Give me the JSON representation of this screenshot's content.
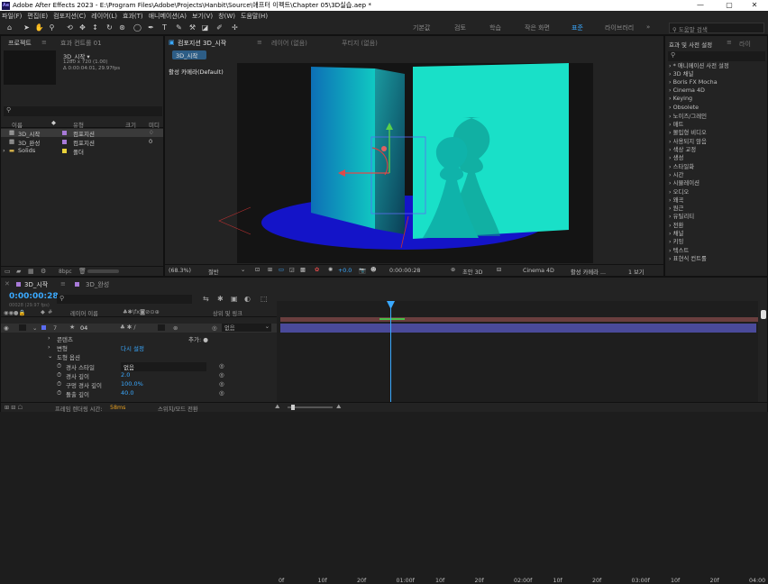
{
  "title": "Adobe After Effects 2023 - E:\\Program Files\\Adobe\\Projects\\Hanbit\\Source\\애프터 이펙트\\Chapter 05\\3D실습.aep *",
  "menu": [
    "파일(F)",
    "편집(E)",
    "컴포지션(C)",
    "레이어(L)",
    "효과(T)",
    "애니메이션(A)",
    "보기(V)",
    "창(W)",
    "도움말(H)"
  ],
  "workspaces": [
    "기본값",
    "검토",
    "학습",
    "작은 화면",
    "표준",
    "라이브러리"
  ],
  "active_workspace": "표준",
  "search_help_placeholder": "도움말 검색",
  "project": {
    "tab": "프로젝트",
    "effect_controls_tab": "효과 컨트롤 01",
    "comp_name": "3D_시작 ▾",
    "comp_info1": "1280 x 720 (1.00)",
    "comp_info2": "Δ 0:00:04:01, 29.97fps",
    "search_placeholder": "",
    "columns": [
      "이름",
      "유형",
      "크기",
      "미디"
    ],
    "items": [
      {
        "name": "3D_시작",
        "color": "#a87ad8",
        "type": "컴포지션",
        "size": "",
        "extra": "♢"
      },
      {
        "name": "3D_완성",
        "color": "#a87ad8",
        "type": "컴포지션",
        "size": "",
        "extra": "0"
      },
      {
        "name": "Solids",
        "color": "#e8d13a",
        "type": "폴더",
        "size": "",
        "extra": ""
      }
    ],
    "bpc": "8bpc"
  },
  "viewer": {
    "tab_comp": "컴포지션 3D_시작",
    "tab_layer": "레이어 (없음)",
    "tab_footage": "푸티지 (없음)",
    "breadcrumb": "3D_시작",
    "camera_label": "활성 카메라(Default)",
    "zoom": "(68.3%)",
    "quality": "절반",
    "timecode": "0:00:00:28",
    "exposure": "+0.0",
    "draft3d": "초안 3D",
    "renderer": "Cinema 4D",
    "camera_select": "활성 카메라 ...",
    "views": "1 보기"
  },
  "effects_panel": {
    "tab": "효과 및 사전 설정",
    "tab2": "라이",
    "search_placeholder": "",
    "categories": [
      "* 애니메이션 사전 설정",
      "3D 채널",
      "Boris FX Mocha",
      "Cinema 4D",
      "Keying",
      "Obsolete",
      "노이즈/그레인",
      "매트",
      "몰입형 비디오",
      "사용되지 않음",
      "색상 교정",
      "생성",
      "스타일화",
      "시간",
      "시뮬레이션",
      "오디오",
      "왜곡",
      "원근",
      "유틸리티",
      "전환",
      "채널",
      "키잉",
      "텍스트",
      "표현식 컨트롤"
    ]
  },
  "timeline": {
    "tab1": "3D_시작",
    "tab2": "3D_완성",
    "timecode": "0:00:00:28",
    "frames": "00028 (29.97 fps)",
    "ruler": [
      "0f",
      "10f",
      "20f",
      "01:00f",
      "10f",
      "20f",
      "02:00f",
      "10f",
      "20f",
      "03:00f",
      "10f",
      "20f",
      "04:00"
    ],
    "header": {
      "layer_name": "레이어 이름",
      "parent": "상위 및 링크",
      "switches": "♣✱\\fx◙⊘⊙⊕"
    },
    "layers": [
      {
        "num": "7",
        "name": "04",
        "parent": "없음"
      }
    ],
    "props": [
      {
        "name": "콘텐츠",
        "value": "",
        "indent": 1,
        "add": "추가: ●"
      },
      {
        "name": "변형",
        "value": "다시 설정",
        "indent": 1,
        "add": ""
      },
      {
        "name": "도형 옵션",
        "value": "",
        "indent": 1,
        "add": ""
      },
      {
        "name": "경사 스타일",
        "value": "없음",
        "indent": 2,
        "add": ""
      },
      {
        "name": "경사 깊이",
        "value": "2.0",
        "indent": 2,
        "add": ""
      },
      {
        "name": "구멍 경사 깊이",
        "value": "100.0%",
        "indent": 2,
        "add": ""
      },
      {
        "name": "돌출 깊이",
        "value": "40.0",
        "indent": 2,
        "add": ""
      }
    ],
    "footer_left": "프레임 렌더링 시간:",
    "footer_ms": "58ms",
    "footer_mid": "스위치/모드 전환",
    "playhead_label": "01:00f"
  },
  "colors": {
    "accent": "#3aa9ff",
    "teal": "#19e0c8",
    "floor": "#1414c8",
    "label_purple": "#a87ad8"
  }
}
